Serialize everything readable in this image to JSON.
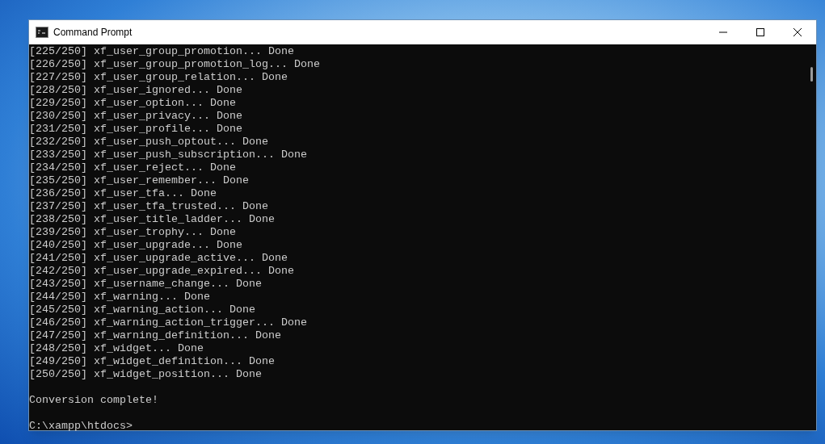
{
  "window": {
    "title": "Command Prompt"
  },
  "console": {
    "output": [
      "[225/250] xf_user_group_promotion... Done",
      "[226/250] xf_user_group_promotion_log... Done",
      "[227/250] xf_user_group_relation... Done",
      "[228/250] xf_user_ignored... Done",
      "[229/250] xf_user_option... Done",
      "[230/250] xf_user_privacy... Done",
      "[231/250] xf_user_profile... Done",
      "[232/250] xf_user_push_optout... Done",
      "[233/250] xf_user_push_subscription... Done",
      "[234/250] xf_user_reject... Done",
      "[235/250] xf_user_remember... Done",
      "[236/250] xf_user_tfa... Done",
      "[237/250] xf_user_tfa_trusted... Done",
      "[238/250] xf_user_title_ladder... Done",
      "[239/250] xf_user_trophy... Done",
      "[240/250] xf_user_upgrade... Done",
      "[241/250] xf_user_upgrade_active... Done",
      "[242/250] xf_user_upgrade_expired... Done",
      "[243/250] xf_username_change... Done",
      "[244/250] xf_warning... Done",
      "[245/250] xf_warning_action... Done",
      "[246/250] xf_warning_action_trigger... Done",
      "[247/250] xf_warning_definition... Done",
      "[248/250] xf_widget... Done",
      "[249/250] xf_widget_definition... Done",
      "[250/250] xf_widget_position... Done"
    ],
    "message": "Conversion complete!",
    "prompt": "C:\\xampp\\htdocs>"
  }
}
